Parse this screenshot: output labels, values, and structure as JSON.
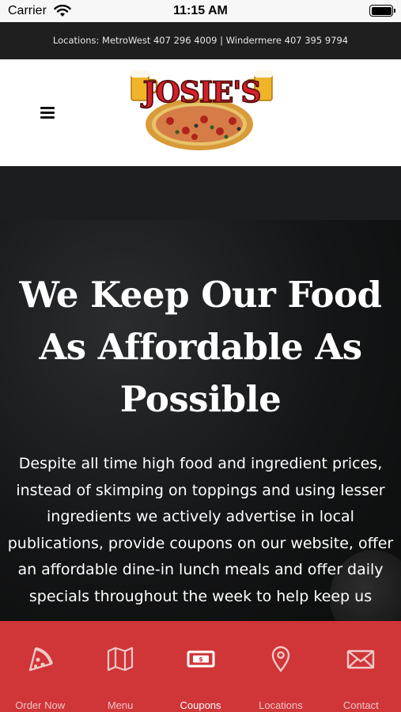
{
  "status_bar": {
    "carrier": "Carrier",
    "time": "11:15 AM"
  },
  "location_bar": {
    "text": "Locations: MetroWest 407 296 4009 | Windermere 407 395 9794"
  },
  "header": {
    "logo_text": "JOSIE'S"
  },
  "hero": {
    "title_lines": [
      "We Keep Our Food",
      "As Affordable As",
      "Possible"
    ],
    "body_lines": [
      "Despite all time high food and ingredient prices,",
      "instead of skimping on toppings and using lesser",
      "ingredients we actively advertise in local",
      "publications, provide coupons on our website, offer",
      "an affordable dine-in lunch meals and offer daily",
      "specials throughout the week to help keep us"
    ]
  },
  "tab_bar": {
    "active_tab": "Coupons",
    "tabs": [
      {
        "label": "Order Now",
        "icon": "pizza-slice-icon"
      },
      {
        "label": "Menu",
        "icon": "map-icon"
      },
      {
        "label": "Coupons",
        "icon": "money-bill-icon"
      },
      {
        "label": "Locations",
        "icon": "map-pin-icon"
      },
      {
        "label": "Contact",
        "icon": "envelope-icon"
      }
    ]
  },
  "colors": {
    "location_bar_bg": "#1f1f1f",
    "tab_bar_bg": "#d03537",
    "logo_red": "#d6202a",
    "hero_bg": "#141516"
  }
}
